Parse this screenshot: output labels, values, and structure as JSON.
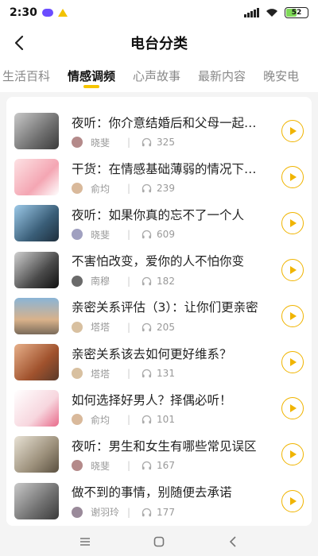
{
  "status_bar": {
    "time": "2:30",
    "battery": "52",
    "battery_level": 0.52
  },
  "header": {
    "title": "电台分类"
  },
  "tabs": [
    {
      "label": "生活百科",
      "active": false
    },
    {
      "label": "情感调频",
      "active": true
    },
    {
      "label": "心声故事",
      "active": false
    },
    {
      "label": "最新内容",
      "active": false
    },
    {
      "label": "晚安电",
      "active": false
    }
  ],
  "colors": {
    "accent": "#f6c500",
    "play": "#f0b400"
  },
  "items": [
    {
      "title": "夜听：你介意结婚后和父母一起住吗？",
      "author": "晓斐",
      "plays": "325"
    },
    {
      "title": "干货：在情感基础薄弱的情况下结婚",
      "author": "俞均",
      "plays": "239"
    },
    {
      "title": "夜听：如果你真的忘不了一个人",
      "author": "晓斐",
      "plays": "609"
    },
    {
      "title": "不害怕改变，爱你的人不怕你变",
      "author": "南穆",
      "plays": "182"
    },
    {
      "title": "亲密关系评估（3）：让你们更亲密",
      "author": "塔塔",
      "plays": "205"
    },
    {
      "title": "亲密关系该去如何更好维系？",
      "author": "塔塔",
      "plays": "131"
    },
    {
      "title": "如何选择好男人？择偶必听！",
      "author": "俞均",
      "plays": "101"
    },
    {
      "title": "夜听：男生和女生有哪些常见误区",
      "author": "晓斐",
      "plays": "167"
    },
    {
      "title": "做不到的事情，别随便去承诺",
      "author": "谢羽玲",
      "plays": "177"
    }
  ],
  "icons": {
    "back": "chevron-left-icon",
    "listen": "headphones-icon",
    "play": "play-icon",
    "nav_menu": "menu-icon",
    "nav_home": "square-icon",
    "nav_back": "triangle-back-icon"
  }
}
